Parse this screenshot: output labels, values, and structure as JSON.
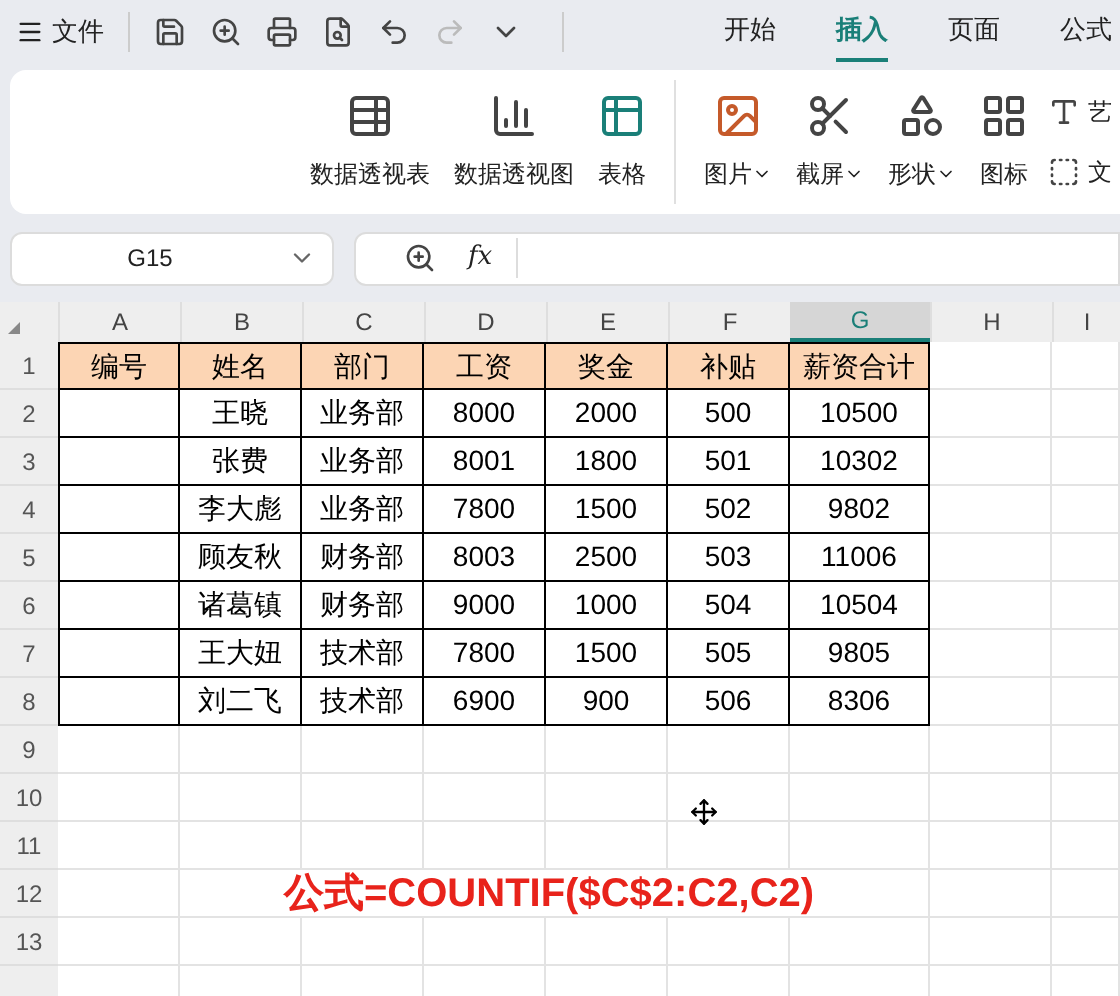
{
  "top_bar": {
    "menu_label": "文件",
    "tabs": [
      {
        "label": "开始",
        "selected": false
      },
      {
        "label": "插入",
        "selected": true
      },
      {
        "label": "页面",
        "selected": false
      },
      {
        "label": "公式",
        "selected": false
      }
    ]
  },
  "ribbon": {
    "large_items": [
      {
        "label": "数据透视表",
        "kind": "pivot-table",
        "dropdown": false
      },
      {
        "label": "数据透视图",
        "kind": "pivot-chart",
        "dropdown": false
      },
      {
        "label": "表格",
        "kind": "table",
        "dropdown": false
      },
      {
        "label": "图片",
        "kind": "image",
        "dropdown": true
      },
      {
        "label": "截屏",
        "kind": "screenshot",
        "dropdown": true
      },
      {
        "label": "形状",
        "kind": "shapes",
        "dropdown": true
      },
      {
        "label": "图标",
        "kind": "icons",
        "dropdown": false
      }
    ],
    "small_items": [
      {
        "label": "艺",
        "kind": "art-text"
      },
      {
        "label": "文",
        "kind": "text-box"
      }
    ]
  },
  "formula_bar": {
    "name_box": "G15",
    "fx": "fx"
  },
  "sheet": {
    "columns": [
      {
        "label": "A",
        "selected": false
      },
      {
        "label": "B",
        "selected": false
      },
      {
        "label": "C",
        "selected": false
      },
      {
        "label": "D",
        "selected": false
      },
      {
        "label": "E",
        "selected": false
      },
      {
        "label": "F",
        "selected": false
      },
      {
        "label": "G",
        "selected": true
      },
      {
        "label": "H",
        "selected": false
      },
      {
        "label": "I",
        "selected": false
      }
    ],
    "row_numbers": [
      "1",
      "2",
      "3",
      "4",
      "5",
      "6",
      "7",
      "8",
      "9",
      "10",
      "11",
      "12",
      "13"
    ],
    "table_header": [
      "编号",
      "姓名",
      "部门",
      "工资",
      "奖金",
      "补贴",
      "薪资合计"
    ],
    "table_rows": [
      [
        "王晓",
        "业务部",
        "8000",
        "2000",
        "500",
        "10500"
      ],
      [
        "张费",
        "业务部",
        "8001",
        "1800",
        "501",
        "10302"
      ],
      [
        "李大彪",
        "业务部",
        "7800",
        "1500",
        "502",
        "9802"
      ],
      [
        "顾友秋",
        "财务部",
        "8003",
        "2500",
        "503",
        "11006"
      ],
      [
        "诸葛镇",
        "财务部",
        "9000",
        "1000",
        "504",
        "10504"
      ],
      [
        "王大妞",
        "技术部",
        "7800",
        "1500",
        "505",
        "9805"
      ],
      [
        "刘二飞",
        "技术部",
        "6900",
        "900",
        "506",
        "8306"
      ]
    ],
    "formula_note": "公式=COUNTIF($C$2:C2,C2)"
  }
}
